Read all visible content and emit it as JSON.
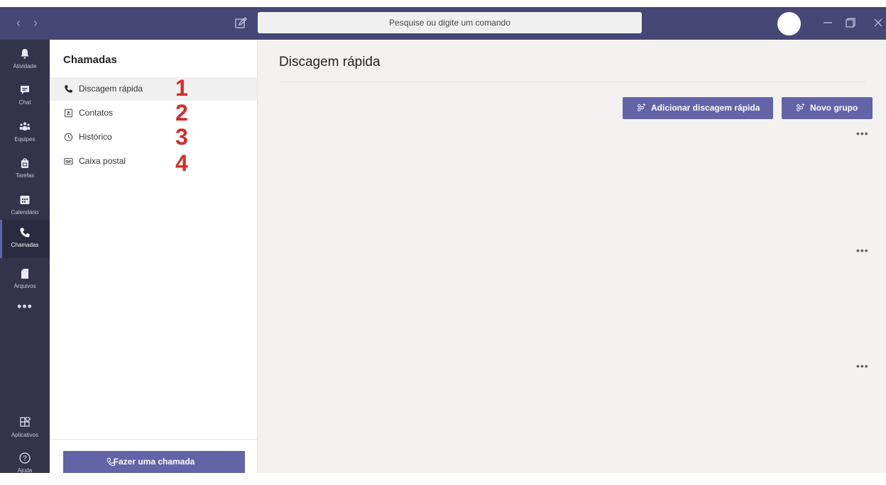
{
  "app": {
    "search_placeholder": "Pesquise ou digite um comando"
  },
  "rail": {
    "items": [
      {
        "label": "Atividade",
        "icon": "bell-icon"
      },
      {
        "label": "Chat",
        "icon": "chat-icon"
      },
      {
        "label": "Equipes",
        "icon": "teams-icon"
      },
      {
        "label": "Tarefas",
        "icon": "tasks-bag-icon"
      },
      {
        "label": "Calendário",
        "icon": "calendar-icon"
      },
      {
        "label": "Chamadas",
        "icon": "phone-icon"
      },
      {
        "label": "Arquivos",
        "icon": "file-icon"
      }
    ],
    "more": "•••",
    "apps_label": "Aplicativos",
    "help_label": "Ajuda"
  },
  "panel": {
    "title": "Chamadas",
    "items": [
      {
        "label": "Discagem rápida",
        "marker": "1",
        "icon": "phone-icon"
      },
      {
        "label": "Contatos",
        "marker": "2",
        "icon": "contact-card-icon"
      },
      {
        "label": "Histórico",
        "marker": "3",
        "icon": "clock-icon"
      },
      {
        "label": "Caixa postal",
        "marker": "4",
        "icon": "voicemail-icon"
      }
    ],
    "call_button": "Fazer uma chamada"
  },
  "main": {
    "title": "Discagem rápida",
    "add_speed_dial_button": "Adicionar discagem rápida",
    "new_group_button": "Novo grupo",
    "more_options": "•••"
  },
  "colors": {
    "titlebar": "#464775",
    "rail": "#33344a",
    "accent": "#6264a7",
    "marker": "#d62b2b",
    "main_bg": "#f3f2f1"
  }
}
